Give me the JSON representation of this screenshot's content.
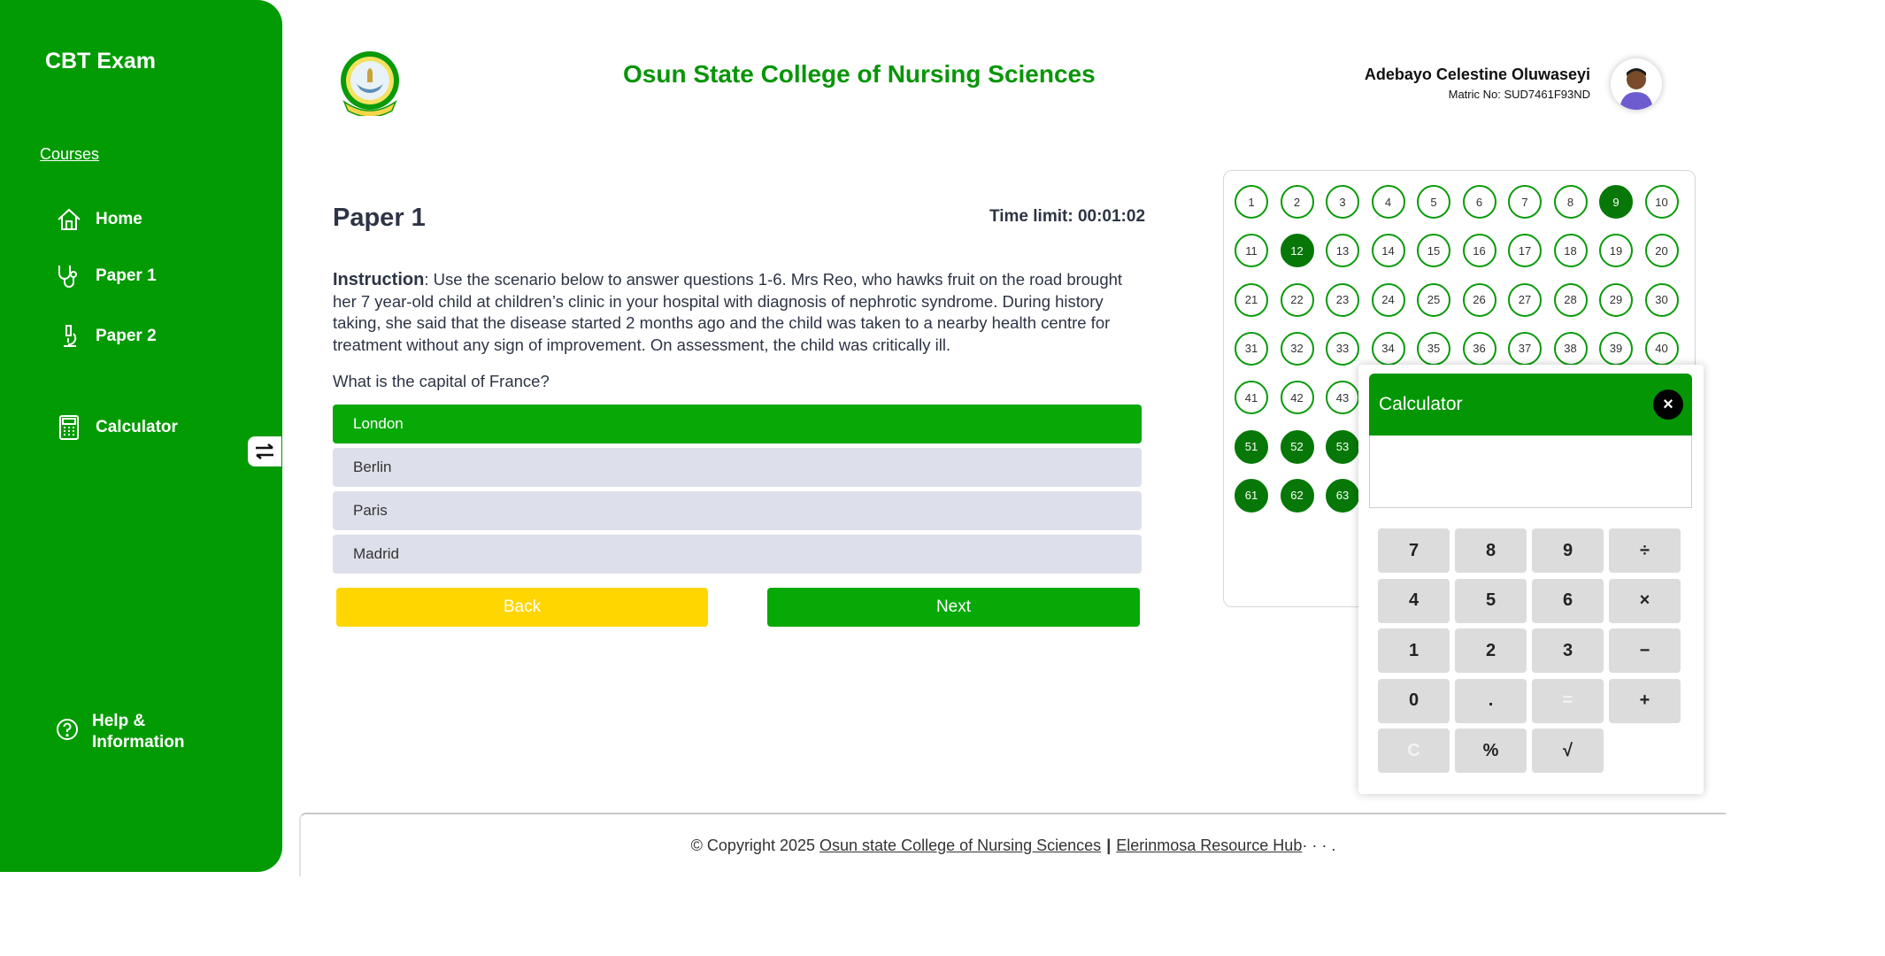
{
  "sidebar": {
    "brand": "CBT Exam",
    "courses_label": "Courses",
    "items": [
      {
        "label": "Home",
        "icon": "home-icon"
      },
      {
        "label": "Paper 1",
        "icon": "stethoscope-icon"
      },
      {
        "label": "Paper 2",
        "icon": "microscope-icon"
      },
      {
        "label": "Calculator",
        "icon": "calculator-icon"
      }
    ],
    "help_line1": "Help &",
    "help_line2": "Information"
  },
  "header": {
    "college_name": "Osun State College of Nursing Sciences",
    "user_name": "Adebayo Celestine Oluwaseyi",
    "matric": "Matric No: SUD7461F93ND"
  },
  "exam": {
    "paper_title": "Paper 1",
    "time_label": "Time limit:",
    "time_value": "00:01:02",
    "instruction_label": "Instruction",
    "instruction_text": ": Use the scenario below to answer questions 1-6. Mrs Reo, who hawks fruit on the road brought her 7 year-old child at children’s clinic in your hospital with diagnosis of nephrotic syndrome. During history taking, she said that the disease started 2 months ago and the child was taken to a nearby health centre for treatment without any sign of improvement. On assessment, the child was critically ill.",
    "question": "What is the capital of France?",
    "options": [
      "London",
      "Berlin",
      "Paris",
      "Madrid"
    ],
    "selected_option": 0,
    "back_label": "Back",
    "next_label": "Next"
  },
  "navigator": {
    "visible_numbers": [
      1,
      2,
      3,
      4,
      5,
      6,
      7,
      8,
      9,
      10,
      11,
      12,
      13,
      14,
      15,
      16,
      17,
      18,
      19,
      20,
      21,
      22,
      23,
      24,
      25,
      26,
      27,
      28,
      29,
      30,
      31,
      32,
      33,
      34,
      35,
      36,
      37,
      38,
      39,
      40,
      41,
      42,
      43,
      51,
      52,
      53,
      61,
      62,
      63
    ],
    "answered": [
      9,
      12,
      51,
      52,
      53,
      61,
      62,
      63
    ]
  },
  "calculator": {
    "title": "Calculator",
    "close_label": "×",
    "display": "",
    "keys": [
      "7",
      "8",
      "9",
      "÷",
      "4",
      "5",
      "6",
      "×",
      "1",
      "2",
      "3",
      "−",
      "0",
      ".",
      "=",
      "+",
      "C",
      "%",
      "√"
    ]
  },
  "footer": {
    "copyright": "© Copyright 2025",
    "link1": "Osun state College of Nursing Sciences",
    "separator": "|",
    "link2": "Elerinmosa Resource Hub",
    "trail": "· · · ."
  },
  "colors": {
    "primary_green": "#039b03",
    "selected_option": "#07a907",
    "back_button": "#ffd600",
    "answered_bubble": "#077807"
  }
}
